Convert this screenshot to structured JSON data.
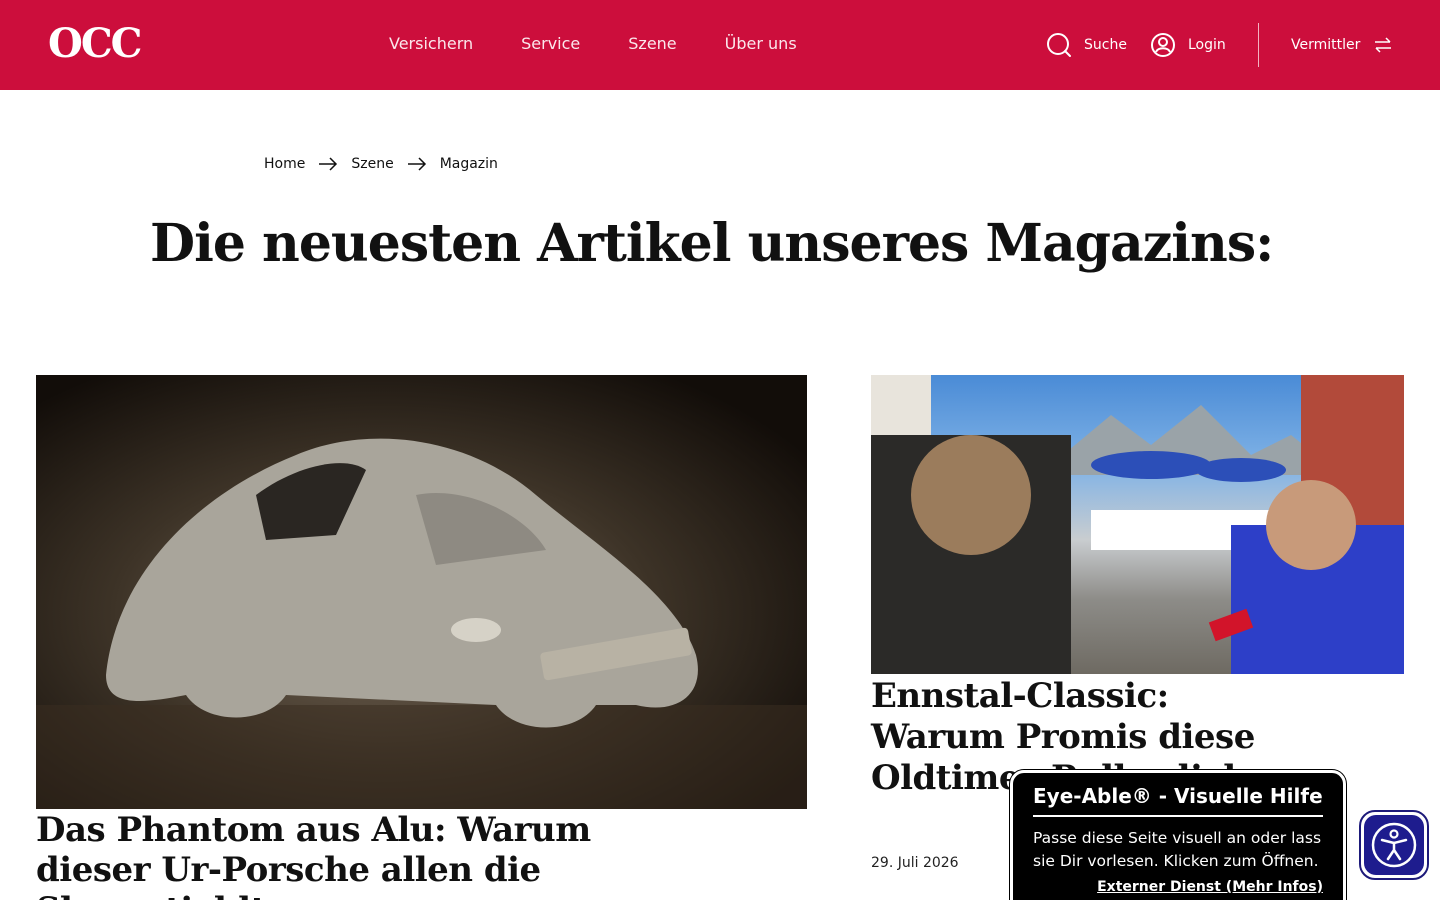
{
  "header": {
    "logo": "OCC",
    "nav": [
      "Versichern",
      "Service",
      "Szene",
      "Über uns"
    ],
    "search_label": "Suche",
    "login_label": "Login",
    "vermittler_label": "Vermittler",
    "bg_color": "#cc0e3c",
    "icons": [
      "search-icon",
      "user-icon",
      "swap-arrows-icon"
    ]
  },
  "breadcrumb": [
    "Home",
    "Szene",
    "Magazin"
  ],
  "page": {
    "title": "Die neuesten Artikel unseres Magazins:"
  },
  "articles": [
    {
      "title": "Das Phantom aus Alu: Warum dieser Ur-Porsche allen die Show stiehlt",
      "image": "silver-porsche-car-photo"
    },
    {
      "title": "Ennstal-Classic: Warum Promis diese Oldtimer-Rallye lieben",
      "date": "29. Juli 2026",
      "image": "ennstal-classic-interview-photo"
    }
  ],
  "eye_able": {
    "title": "Eye-Able® - Visuelle Hilfe",
    "body": "Passe diese Seite visuell an oder lass sie Dir vorlesen. Klicken zum Öffnen.",
    "link": "Externer Dienst (Mehr Infos)",
    "button_icon": "accessibility-icon"
  }
}
